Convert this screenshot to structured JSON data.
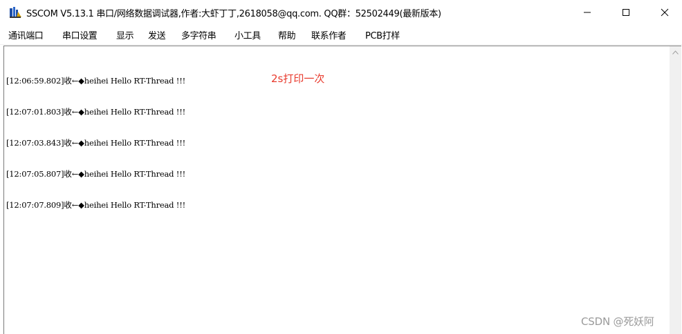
{
  "window": {
    "title": "SSCOM V5.13.1 串口/网络数据调试器,作者:大虾丁丁,2618058@qq.com. QQ群：52502449(最新版本)"
  },
  "menu": {
    "items": [
      {
        "label": "通讯端口"
      },
      {
        "label": "串口设置"
      },
      {
        "label": "显示"
      },
      {
        "label": "发送"
      },
      {
        "label": "多字符串"
      },
      {
        "label": "小工具"
      },
      {
        "label": "帮助"
      },
      {
        "label": "联系作者"
      },
      {
        "label": "PCB打样"
      }
    ]
  },
  "log": {
    "lines": [
      {
        "text": "[12:06:59.802]收←◆heihei Hello RT-Thread !!!"
      },
      {
        "text": "[12:07:01.803]收←◆heihei Hello RT-Thread !!!"
      },
      {
        "text": "[12:07:03.843]收←◆heihei Hello RT-Thread !!!"
      },
      {
        "text": "[12:07:05.807]收←◆heihei Hello RT-Thread !!!"
      },
      {
        "text": "[12:07:07.809]收←◆heihei Hello RT-Thread !!!"
      }
    ]
  },
  "annotation": {
    "text": "2s打印一次",
    "color": "#e8392c"
  },
  "watermark": {
    "text": "CSDN @死妖阿"
  },
  "icons": {
    "app": "sscom-app-icon",
    "minimize": "minimize-icon",
    "maximize": "maximize-icon",
    "close": "close-icon",
    "scroll_up": "scroll-up-arrow-icon"
  }
}
